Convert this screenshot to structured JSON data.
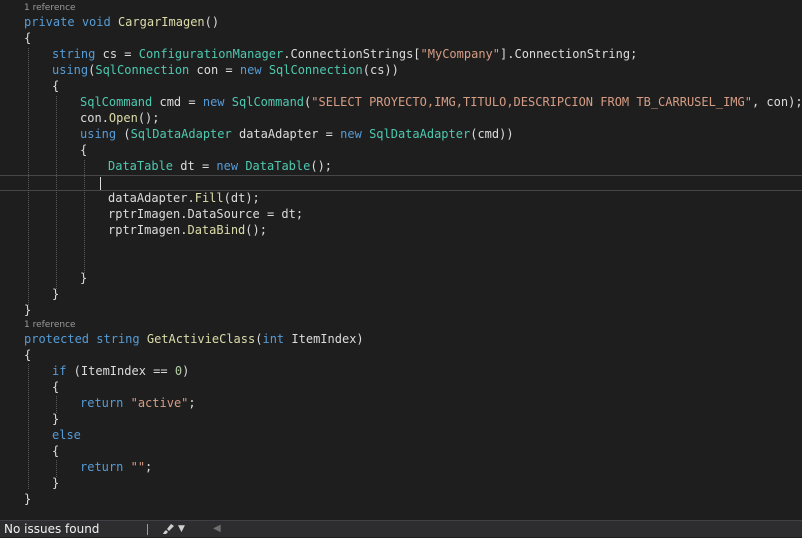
{
  "code_lens": {
    "ref1": "1 reference",
    "ref2": "1 reference"
  },
  "code": [
    {
      "id": "l01",
      "t": [
        [
          "private",
          "kw"
        ],
        [
          " ",
          "pn"
        ],
        [
          "void",
          "kw"
        ],
        [
          " ",
          "pn"
        ],
        [
          "CargarImagen",
          "mt"
        ],
        [
          "()",
          "pn"
        ]
      ]
    },
    {
      "id": "l02",
      "t": [
        [
          "{",
          "pn"
        ]
      ]
    },
    {
      "id": "l03",
      "t": [
        [
          "string",
          "kw"
        ],
        [
          " ",
          "pn"
        ],
        [
          "cs",
          "id"
        ],
        [
          " = ",
          "pn"
        ],
        [
          "ConfigurationManager",
          "ty"
        ],
        [
          ".",
          "pn"
        ],
        [
          "ConnectionStrings",
          "id"
        ],
        [
          "[",
          "pn"
        ],
        [
          "\"MyCompany\"",
          "str"
        ],
        [
          "].",
          "pn"
        ],
        [
          "ConnectionString",
          "id"
        ],
        [
          ";",
          "pn"
        ]
      ]
    },
    {
      "id": "l04",
      "t": [
        [
          "using",
          "kw"
        ],
        [
          "(",
          "pn"
        ],
        [
          "SqlConnection",
          "ty"
        ],
        [
          " ",
          "pn"
        ],
        [
          "con",
          "id"
        ],
        [
          " = ",
          "pn"
        ],
        [
          "new",
          "kw"
        ],
        [
          " ",
          "pn"
        ],
        [
          "SqlConnection",
          "ty"
        ],
        [
          "(",
          "pn"
        ],
        [
          "cs",
          "id"
        ],
        [
          "))",
          "pn"
        ]
      ]
    },
    {
      "id": "l05",
      "t": [
        [
          "{",
          "pn"
        ]
      ]
    },
    {
      "id": "l06",
      "t": [
        [
          "SqlCommand",
          "ty"
        ],
        [
          " ",
          "pn"
        ],
        [
          "cmd",
          "id"
        ],
        [
          " = ",
          "pn"
        ],
        [
          "new",
          "kw"
        ],
        [
          " ",
          "pn"
        ],
        [
          "SqlCommand",
          "ty"
        ],
        [
          "(",
          "pn"
        ],
        [
          "\"SELECT PROYECTO,IMG,TITULO,DESCRIPCION FROM TB_CARRUSEL_IMG\"",
          "str"
        ],
        [
          ", ",
          "pn"
        ],
        [
          "con",
          "id"
        ],
        [
          ");",
          "pn"
        ]
      ]
    },
    {
      "id": "l07",
      "t": [
        [
          "con",
          "id"
        ],
        [
          ".",
          "pn"
        ],
        [
          "Open",
          "mt"
        ],
        [
          "();",
          "pn"
        ]
      ]
    },
    {
      "id": "l08",
      "t": [
        [
          "using",
          "kw"
        ],
        [
          " (",
          "pn"
        ],
        [
          "SqlDataAdapter",
          "ty"
        ],
        [
          " ",
          "pn"
        ],
        [
          "dataAdapter",
          "id"
        ],
        [
          " = ",
          "pn"
        ],
        [
          "new",
          "kw"
        ],
        [
          " ",
          "pn"
        ],
        [
          "SqlDataAdapter",
          "ty"
        ],
        [
          "(",
          "pn"
        ],
        [
          "cmd",
          "id"
        ],
        [
          "))",
          "pn"
        ]
      ]
    },
    {
      "id": "l09",
      "t": [
        [
          "{",
          "pn"
        ]
      ]
    },
    {
      "id": "l10",
      "t": [
        [
          "DataTable",
          "ty"
        ],
        [
          " ",
          "pn"
        ],
        [
          "dt",
          "id"
        ],
        [
          " = ",
          "pn"
        ],
        [
          "new",
          "kw"
        ],
        [
          " ",
          "pn"
        ],
        [
          "DataTable",
          "ty"
        ],
        [
          "();",
          "pn"
        ]
      ]
    },
    {
      "id": "l11",
      "t": []
    },
    {
      "id": "l12",
      "t": [
        [
          "dataAdapter",
          "id"
        ],
        [
          ".",
          "pn"
        ],
        [
          "Fill",
          "mt"
        ],
        [
          "(",
          "pn"
        ],
        [
          "dt",
          "id"
        ],
        [
          ");",
          "pn"
        ]
      ]
    },
    {
      "id": "l13",
      "t": [
        [
          "rptrImagen",
          "id"
        ],
        [
          ".",
          "pn"
        ],
        [
          "DataSource",
          "id"
        ],
        [
          " = ",
          "pn"
        ],
        [
          "dt",
          "id"
        ],
        [
          ";",
          "pn"
        ]
      ]
    },
    {
      "id": "l14",
      "t": [
        [
          "rptrImagen",
          "id"
        ],
        [
          ".",
          "pn"
        ],
        [
          "DataBind",
          "mt"
        ],
        [
          "();",
          "pn"
        ]
      ]
    },
    {
      "id": "l15",
      "t": []
    },
    {
      "id": "l16",
      "t": []
    },
    {
      "id": "l17",
      "t": [
        [
          "}",
          "pn"
        ]
      ]
    },
    {
      "id": "l18",
      "t": [
        [
          "}",
          "pn"
        ]
      ]
    },
    {
      "id": "l19",
      "t": [
        [
          "}",
          "pn"
        ]
      ]
    },
    {
      "id": "l20",
      "t": [
        [
          "protected",
          "kw"
        ],
        [
          " ",
          "pn"
        ],
        [
          "string",
          "kw"
        ],
        [
          " ",
          "pn"
        ],
        [
          "GetActivieClass",
          "mt"
        ],
        [
          "(",
          "pn"
        ],
        [
          "int",
          "kw"
        ],
        [
          " ",
          "pn"
        ],
        [
          "ItemIndex",
          "id"
        ],
        [
          ")",
          "pn"
        ]
      ]
    },
    {
      "id": "l21",
      "t": [
        [
          "{",
          "pn"
        ]
      ]
    },
    {
      "id": "l22",
      "t": [
        [
          "if",
          "kw"
        ],
        [
          " (",
          "pn"
        ],
        [
          "ItemIndex",
          "id"
        ],
        [
          " == ",
          "pn"
        ],
        [
          "0",
          "num"
        ],
        [
          ")",
          "pn"
        ]
      ]
    },
    {
      "id": "l23",
      "t": [
        [
          "{",
          "pn"
        ]
      ]
    },
    {
      "id": "l24",
      "t": [
        [
          "return",
          "kw"
        ],
        [
          " ",
          "pn"
        ],
        [
          "\"active\"",
          "str"
        ],
        [
          ";",
          "pn"
        ]
      ]
    },
    {
      "id": "l25",
      "t": [
        [
          "}",
          "pn"
        ]
      ]
    },
    {
      "id": "l26",
      "t": [
        [
          "else",
          "kw"
        ]
      ]
    },
    {
      "id": "l27",
      "t": [
        [
          "{",
          "pn"
        ]
      ]
    },
    {
      "id": "l28",
      "t": [
        [
          "return",
          "kw"
        ],
        [
          " ",
          "pn"
        ],
        [
          "\"\"",
          "str"
        ],
        [
          ";",
          "pn"
        ]
      ]
    },
    {
      "id": "l29",
      "t": [
        [
          "}",
          "pn"
        ]
      ]
    },
    {
      "id": "l30",
      "t": [
        [
          "}",
          "pn"
        ]
      ]
    }
  ],
  "status_bar": {
    "issues": "No issues found",
    "cleanup_icon": "brush-icon",
    "dropdown_icon": "caret-down-icon",
    "scroll_icon": "caret-left-icon"
  },
  "colors": {
    "background": "#1e1e1e",
    "keyword": "#569cd6",
    "type": "#4ec9b0",
    "string": "#d69d85",
    "method": "#dcdcaa",
    "number": "#b5cea8",
    "text": "#dcdcdc"
  }
}
